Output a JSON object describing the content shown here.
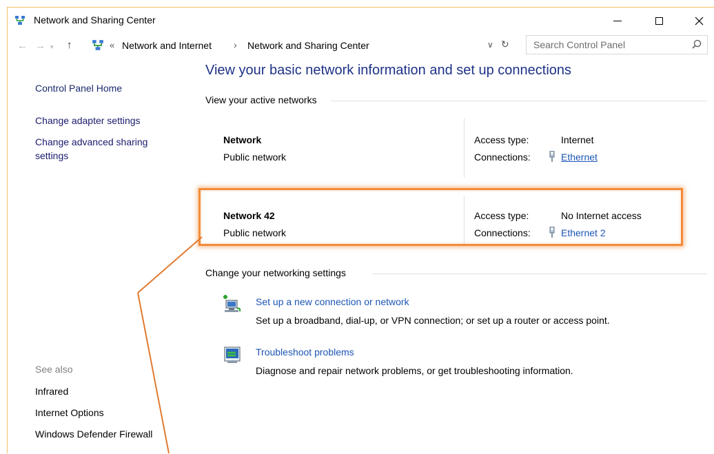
{
  "window": {
    "title": "Network and Sharing Center",
    "controls": {
      "minimize": "–",
      "maximize": "☐",
      "close": "✕"
    }
  },
  "address": {
    "overflow": "«",
    "crumbs": [
      "Network and Internet",
      "Network and Sharing Center"
    ],
    "separator": "›",
    "search_placeholder": "Search Control Panel"
  },
  "left_pane": {
    "home": "Control Panel Home",
    "links": [
      "Change adapter settings",
      "Change advanced sharing settings"
    ],
    "see_also_label": "See also",
    "see_also": [
      "Infrared",
      "Internet Options",
      "Windows Defender Firewall"
    ]
  },
  "main": {
    "title": "View your basic network information and set up connections",
    "active_networks_label": "View your active networks",
    "access_type_label": "Access type:",
    "connections_label": "Connections:",
    "networks": [
      {
        "name": "Network",
        "category": "Public network",
        "access_type": "Internet",
        "connection": "Ethernet"
      },
      {
        "name": "Network 42",
        "category": "Public network",
        "access_type": "No Internet access",
        "connection": "Ethernet 2"
      }
    ],
    "settings_label": "Change your networking settings",
    "tasks": [
      {
        "link": "Set up a new connection or network",
        "description": "Set up a broadband, dial-up, or VPN connection; or set up a router or access point."
      },
      {
        "link": "Troubleshoot problems",
        "description": "Diagnose and repair network problems, or get troubleshooting information."
      }
    ]
  },
  "colors": {
    "highlight": "#f08c3c",
    "link": "#1c55b4",
    "title": "#1e3287"
  }
}
